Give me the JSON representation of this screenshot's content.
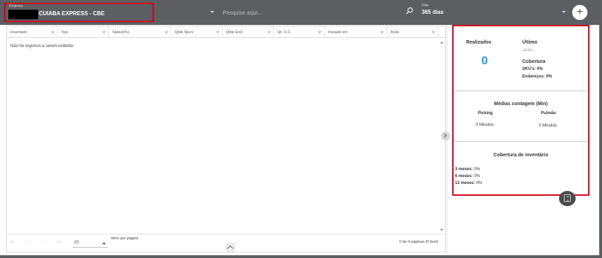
{
  "header": {
    "company_caption": "Empresa",
    "company_name": "CUIABA EXPRESS - CBE",
    "search_placeholder": "Pesquise aqui...",
    "days_caption": "Dias",
    "days_value": "365 dias",
    "add_label": "+"
  },
  "table": {
    "columns": [
      "Inventário",
      "Tipo",
      "Status(%)",
      "Qtde Sku's",
      "Qtde End.",
      "Qt. O.C.",
      "Iniciado em",
      "Ação"
    ],
    "empty_message": "Não há registros a serem exibidos",
    "pager": {
      "first": "|«",
      "prev": "‹",
      "next": "›",
      "last": "»|",
      "page_size": "20",
      "per_page_label": "Itens por página",
      "page_info": "0 de 0 páginas (0 item)"
    }
  },
  "stats": {
    "realizados_label": "Realizados",
    "realizados_value": "0",
    "ultimo_label": "Último",
    "ultimo_value": "--/--/--",
    "cobertura_label": "Cobertura",
    "skus_label": "SKU's: 0%",
    "enderecos_label": "Endereços: 0%",
    "medias_title": "Médias contagem (Min)",
    "picking_label": "Picking",
    "pulmao_label": "Pulmão",
    "picking_value": "0 Minutos",
    "pulmao_value": "0 Minutos",
    "cobertura_inv_title": "Cobertura de inventário",
    "coverage": [
      {
        "label": "3 meses:",
        "value": "0%"
      },
      {
        "label": "6 meses:",
        "value": "0%"
      },
      {
        "label": "12 meses:",
        "value": "0%"
      }
    ]
  },
  "colors": {
    "topbar": "#5d5e62",
    "highlight_border": "#d0021b",
    "accent_number": "#2e9fd1"
  },
  "icons": {
    "search": "search-icon",
    "add": "plus-icon",
    "filter": "filter-icon",
    "collapse": "chevron-up-icon",
    "expand": "chevron-right-icon",
    "report": "document-icon"
  }
}
